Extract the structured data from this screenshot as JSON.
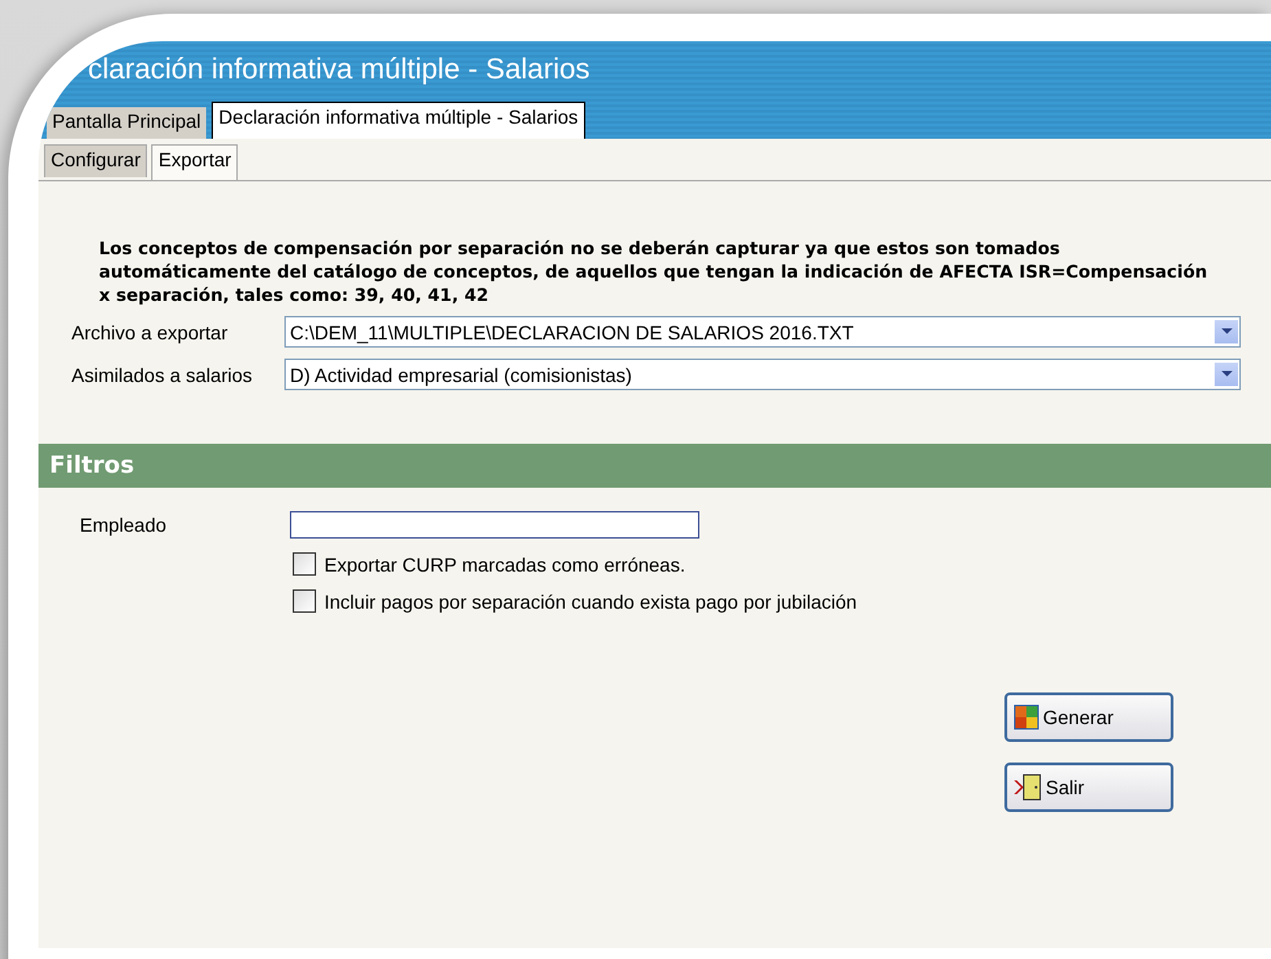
{
  "window": {
    "title": "claración informativa múltiple - Salarios"
  },
  "tabs": [
    {
      "label": "Pantalla Principal",
      "selected": false
    },
    {
      "label": "Declaración informativa múltiple - Salarios",
      "selected": true
    }
  ],
  "subtabs": [
    {
      "label": "Configurar",
      "selected": false
    },
    {
      "label": "Exportar",
      "selected": true
    }
  ],
  "notice": "Los conceptos de compensación por separación no se deberán capturar ya que estos son tomados automáticamente del catálogo de conceptos, de aquellos que tengan la indicación de AFECTA ISR=Compensación x separación, tales como: 39, 40, 41, 42",
  "fields": [
    {
      "label": "Archivo a exportar",
      "value": "C:\\DEM_11\\MULTIPLE\\DECLARACION DE SALARIOS 2016.TXT"
    },
    {
      "label": "Asimilados a salarios",
      "value": "D) Actividad empresarial (comisionistas)"
    }
  ],
  "filters": {
    "title": "Filtros",
    "employee_label": "Empleado",
    "options": [
      {
        "label": "Exportar CURP marcadas como erróneas.",
        "checked": false
      },
      {
        "label": "Incluir pagos por separación cuando exista pago por jubilación",
        "checked": false
      }
    ]
  },
  "buttons": [
    {
      "kind": "generate",
      "label": "Generar"
    },
    {
      "kind": "exit",
      "label": "Salir"
    }
  ]
}
